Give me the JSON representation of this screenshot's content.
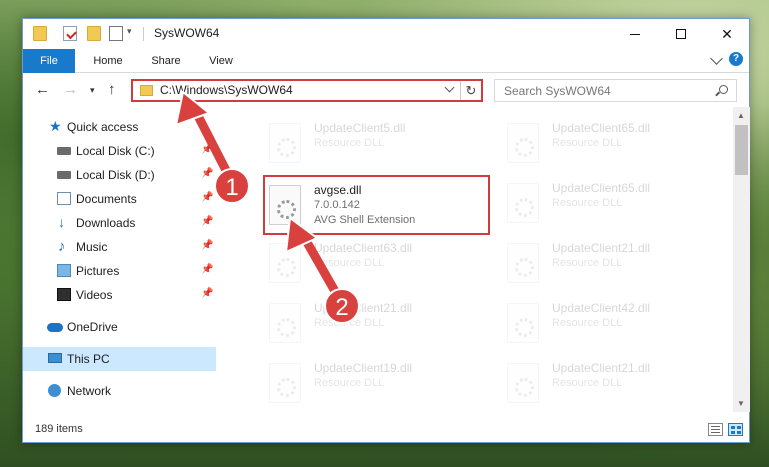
{
  "window": {
    "title": "SysWOW64",
    "controls": {
      "minimize": "minimize",
      "maximize": "maximize",
      "close": "✕"
    }
  },
  "ribbon": {
    "tabs": [
      {
        "label": "File"
      },
      {
        "label": "Home"
      },
      {
        "label": "Share"
      },
      {
        "label": "View"
      }
    ]
  },
  "nav": {
    "address": "C:\\Windows\\SysWOW64",
    "search_placeholder": "Search SysWOW64"
  },
  "sidebar": {
    "items": [
      {
        "label": "Quick access",
        "icon": "star-icon"
      },
      {
        "label": "Local Disk (C:)",
        "icon": "drive-icon",
        "pinned": true
      },
      {
        "label": "Local Disk (D:)",
        "icon": "drive-icon",
        "pinned": true
      },
      {
        "label": "Documents",
        "icon": "documents-icon",
        "pinned": true
      },
      {
        "label": "Downloads",
        "icon": "download-icon",
        "pinned": true
      },
      {
        "label": "Music",
        "icon": "music-icon",
        "pinned": true
      },
      {
        "label": "Pictures",
        "icon": "pictures-icon",
        "pinned": true
      },
      {
        "label": "Videos",
        "icon": "videos-icon",
        "pinned": true
      },
      {
        "label": "OneDrive",
        "icon": "cloud-icon"
      },
      {
        "label": "This PC",
        "icon": "pc-icon",
        "selected": true
      },
      {
        "label": "Network",
        "icon": "network-icon"
      }
    ]
  },
  "files": {
    "highlighted": {
      "name": "avgse.dll",
      "version": "7.0.0.142",
      "description": "AVG Shell Extension"
    },
    "faded": [
      {
        "name": "UpdateClient5.dll",
        "type": "Resource DLL"
      },
      {
        "name": "UpdateClient65.dll",
        "type": "Resource DLL"
      },
      {
        "name": "UpdateClient65.dll",
        "type": "Resource DLL"
      },
      {
        "name": "UpdateClient63.dll",
        "type": "Resource DLL"
      },
      {
        "name": "UpdateClient21.dll",
        "type": "Resource DLL"
      },
      {
        "name": "UpdateClient21.dll",
        "type": "Resource DLL"
      },
      {
        "name": "UpdateClient42.dll",
        "type": "Resource DLL"
      },
      {
        "name": "UpdateClient19.dll",
        "type": "Resource DLL"
      },
      {
        "name": "UpdateClient21.dll",
        "type": "Resource DLL"
      }
    ]
  },
  "status": {
    "item_count": "189 items"
  },
  "annotations": {
    "step1": "1",
    "step2": "2",
    "color": "#d9413f"
  },
  "colors": {
    "accent": "#1979ca",
    "highlight_border": "#d23b3b",
    "selected_bg": "#cce8ff"
  }
}
